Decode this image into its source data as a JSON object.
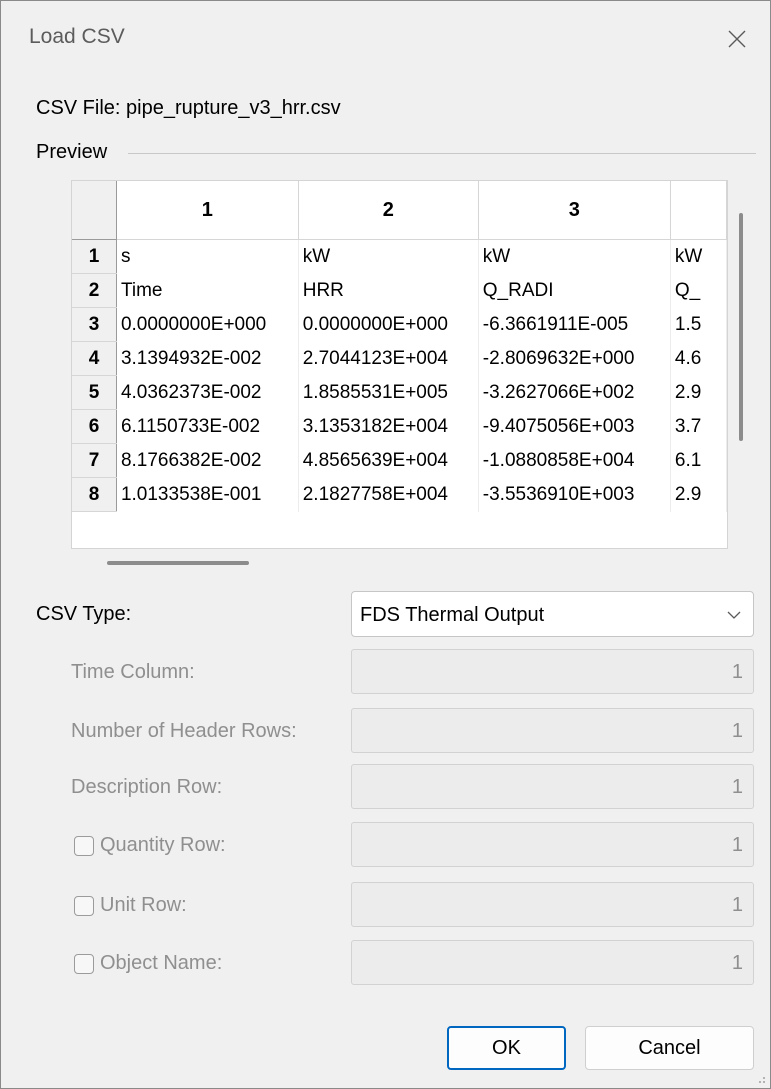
{
  "window": {
    "title": "Load CSV"
  },
  "file": {
    "label": "CSV File: pipe_rupture_v3_hrr.csv"
  },
  "preview": {
    "label": "Preview",
    "column_headers": [
      "1",
      "2",
      "3",
      ""
    ],
    "rows": [
      {
        "num": "1",
        "cells": [
          "s",
          "kW",
          "kW",
          "kW"
        ]
      },
      {
        "num": "2",
        "cells": [
          "Time",
          "HRR",
          "Q_RADI",
          "Q_"
        ]
      },
      {
        "num": "3",
        "cells": [
          "0.0000000E+000",
          "0.0000000E+000",
          "-6.3661911E-005",
          "1.5"
        ]
      },
      {
        "num": "4",
        "cells": [
          "3.1394932E-002",
          "2.7044123E+004",
          "-2.8069632E+000",
          "4.6"
        ]
      },
      {
        "num": "5",
        "cells": [
          "4.0362373E-002",
          "1.8585531E+005",
          "-3.2627066E+002",
          "2.9"
        ]
      },
      {
        "num": "6",
        "cells": [
          "6.1150733E-002",
          "3.1353182E+004",
          "-9.4075056E+003",
          "3.7"
        ]
      },
      {
        "num": "7",
        "cells": [
          "8.1766382E-002",
          "4.8565639E+004",
          "-1.0880858E+004",
          "6.1"
        ]
      },
      {
        "num": "8",
        "cells": [
          "1.0133538E-001",
          "2.1827758E+004",
          "-3.5536910E+003",
          "2.9"
        ]
      }
    ]
  },
  "csv_type": {
    "label": "CSV Type:",
    "value": "FDS Thermal Output"
  },
  "fields": {
    "time_column": {
      "label": "Time Column:",
      "value": "1"
    },
    "header_rows": {
      "label": "Number of Header Rows:",
      "value": "1"
    },
    "description_row": {
      "label": "Description Row:",
      "value": "1"
    },
    "quantity_row": {
      "label": "Quantity Row:",
      "value": "1"
    },
    "unit_row": {
      "label": "Unit Row:",
      "value": "1"
    },
    "object_name": {
      "label": "Object Name:",
      "value": "1"
    }
  },
  "buttons": {
    "ok": "OK",
    "cancel": "Cancel"
  },
  "icons": {
    "close": "close-icon",
    "dropdown": "chevron-down-icon",
    "grip": "resize-grip-icon"
  },
  "colors": {
    "accent": "#0067c0",
    "disabled_text": "#8f8f8f"
  }
}
